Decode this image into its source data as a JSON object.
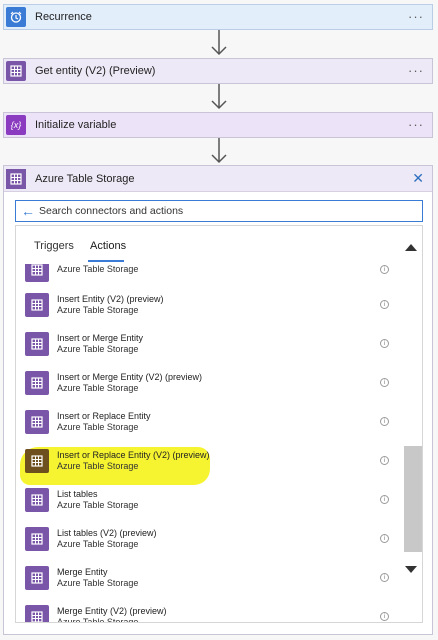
{
  "steps": {
    "recurrence": {
      "title": "Recurrence",
      "more": "···",
      "color": "#3a7bd5"
    },
    "get_entity": {
      "title": "Get entity (V2) (Preview)",
      "more": "···",
      "color": "#7a56a8"
    },
    "initialize_variable": {
      "title": "Initialize variable",
      "more": "···",
      "icon_text": "{x}",
      "color": "#8a3bc0"
    }
  },
  "panel": {
    "title": "Azure Table Storage",
    "close": "✕",
    "search_placeholder": "Search connectors and actions",
    "tabs": [
      "Triggers",
      "Actions"
    ],
    "selected_tab": "Actions",
    "actions": [
      {
        "name": "",
        "connector": "Azure Table Storage"
      },
      {
        "name": "Insert Entity (V2) (preview)",
        "connector": "Azure Table Storage"
      },
      {
        "name": "Insert or Merge Entity",
        "connector": "Azure Table Storage"
      },
      {
        "name": "Insert or Merge Entity (V2) (preview)",
        "connector": "Azure Table Storage"
      },
      {
        "name": "Insert or Replace Entity",
        "connector": "Azure Table Storage"
      },
      {
        "name": "Insert or Replace Entity (V2) (preview)",
        "connector": "Azure Table Storage",
        "highlighted": true
      },
      {
        "name": "List tables",
        "connector": "Azure Table Storage"
      },
      {
        "name": "List tables (V2) (preview)",
        "connector": "Azure Table Storage"
      },
      {
        "name": "Merge Entity",
        "connector": "Azure Table Storage"
      },
      {
        "name": "Merge Entity (V2) (preview)",
        "connector": "Azure Table Storage"
      }
    ],
    "info_glyph": "i"
  },
  "colors": {
    "accent": "#3a7bd5",
    "connector_purple": "#7a56a8",
    "highlight": "#f6f430"
  }
}
